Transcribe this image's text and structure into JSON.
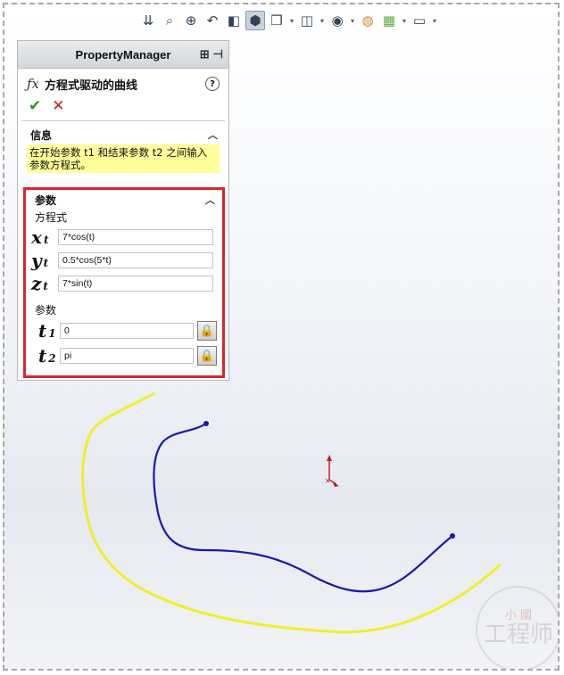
{
  "toolbar": {
    "icons": [
      "view-orient-icon",
      "zoom-fit-icon",
      "zoom-area-icon",
      "previous-view-icon",
      "section-view-icon",
      "display-style-icon",
      "view-cube-icon",
      "hide-show-icon",
      "edit-appearance-icon",
      "scene-icon",
      "monitor-icon"
    ]
  },
  "property_manager": {
    "header": "PropertyManager",
    "feature_title": "方程式驱动的曲线",
    "help_symbol": "?",
    "ok_symbol": "✔",
    "cancel_symbol": "✕"
  },
  "info": {
    "heading": "信息",
    "text": "在开始参数 t1 和结束参数 t2 之间输入参数方程式。"
  },
  "params": {
    "heading": "参数",
    "equation_label": "方程式",
    "x_sym": "x",
    "x_sub": "t",
    "x_value": "7*cos(t)",
    "y_sym": "y",
    "y_sub": "t",
    "y_value": "0.5*cos(5*t)",
    "z_sym": "z",
    "z_sub": "t",
    "z_value": "7*sin(t)",
    "param_label": "参数",
    "t1_sym": "t",
    "t1_sub": "1",
    "t1_value": "0",
    "t2_sym": "t",
    "t2_sub": "2",
    "t2_value": "pi"
  },
  "watermark": {
    "line1": "小 國",
    "line2": "工程师"
  },
  "colors": {
    "curve_blue": "#1a1aa8",
    "curve_yellow": "#f2ee2a",
    "highlight_border": "#d8262e",
    "info_bg": "#ffff99"
  }
}
